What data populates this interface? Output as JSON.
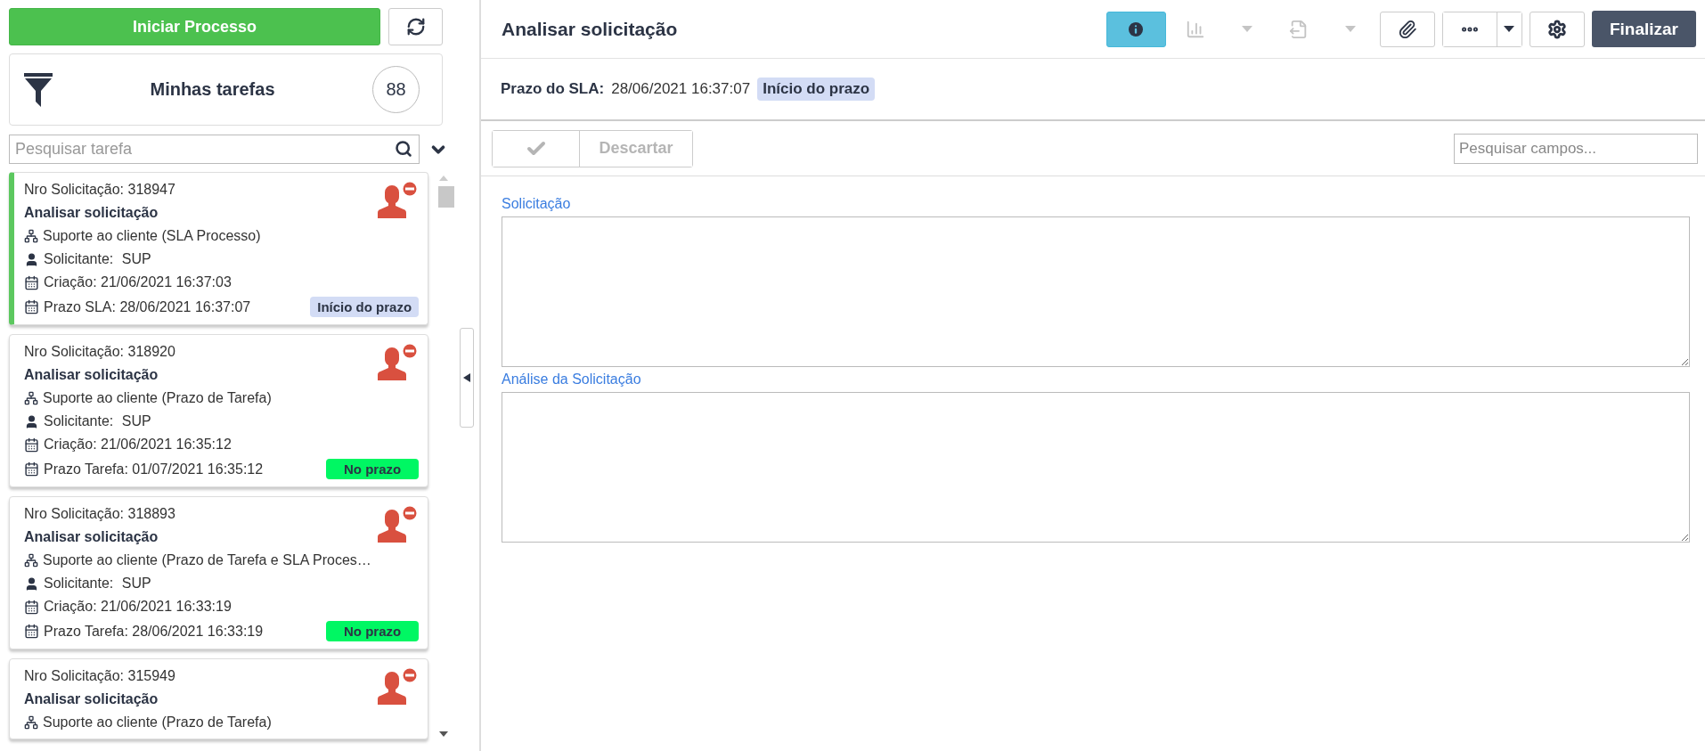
{
  "left_panel": {
    "start_button": "Iniciar Processo",
    "filter": {
      "title": "Minhas tarefas",
      "count": "88"
    },
    "search": {
      "placeholder": "Pesquisar tarefa"
    },
    "tasks": [
      {
        "selected": true,
        "number": "Nro Solicitação: 318947",
        "title": "Analisar solicitação",
        "process": "Suporte ao cliente (SLA Processo)",
        "requester_label": "Solicitante:",
        "requester": "SUP",
        "created": "Criação: 21/06/2021 16:37:03",
        "deadline": "Prazo SLA: 28/06/2021 16:37:07",
        "badge": {
          "text": "Início do prazo",
          "color": "#d3dcf5"
        }
      },
      {
        "selected": false,
        "number": "Nro Solicitação: 318920",
        "title": "Analisar solicitação",
        "process": "Suporte ao cliente (Prazo de Tarefa)",
        "requester_label": "Solicitante:",
        "requester": "SUP",
        "created": "Criação: 21/06/2021 16:35:12",
        "deadline": "Prazo Tarefa: 01/07/2021 16:35:12",
        "badge": {
          "text": "No prazo",
          "color": "#00f763"
        }
      },
      {
        "selected": false,
        "number": "Nro Solicitação: 318893",
        "title": "Analisar solicitação",
        "process": "Suporte ao cliente (Prazo de Tarefa e SLA Proces…",
        "requester_label": "Solicitante:",
        "requester": "SUP",
        "created": "Criação: 21/06/2021 16:33:19",
        "deadline": "Prazo Tarefa: 28/06/2021 16:33:19",
        "badge": {
          "text": "No prazo",
          "color": "#00f763"
        }
      },
      {
        "selected": false,
        "number": "Nro Solicitação: 315949",
        "title": "Analisar solicitação",
        "process": "Suporte ao cliente (Prazo de Tarefa)"
      }
    ]
  },
  "main": {
    "title": "Analisar solicitação",
    "toolbar": {
      "info_active": true,
      "report_disabled": true,
      "export_disabled": true,
      "finish_button": "Finalizar"
    },
    "sla": {
      "label": "Prazo do SLA:",
      "value": "28/06/2021 16:37:07",
      "badge": {
        "text": "Início do prazo",
        "color": "#d3dcf5"
      }
    },
    "form_actions": {
      "discard": "Descartar",
      "disabled": true
    },
    "field_search": {
      "placeholder": "Pesquisar campos..."
    },
    "fields": [
      {
        "label": "Solicitação"
      },
      {
        "label": "Análise da Solicitação"
      }
    ]
  }
}
